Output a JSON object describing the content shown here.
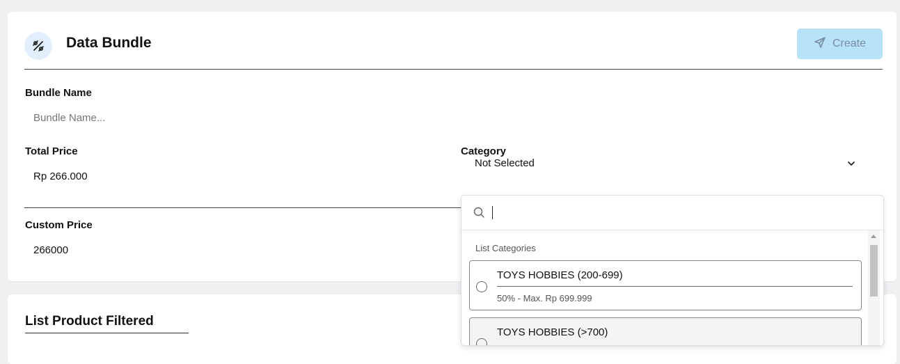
{
  "header": {
    "title": "Data Bundle",
    "icon": "percent-tag-icon",
    "create_label": "Create",
    "create_icon": "send-icon"
  },
  "form": {
    "bundle_name": {
      "label": "Bundle Name",
      "value": "",
      "placeholder": "Bundle Name..."
    },
    "total_price": {
      "label": "Total Price",
      "value": "Rp 266.000"
    },
    "category": {
      "label": "Category",
      "selected": "Not Selected"
    },
    "custom_price": {
      "label": "Custom Price",
      "value": "266000"
    }
  },
  "dropdown": {
    "search_value": "",
    "list_label": "List Categories",
    "options": [
      {
        "title": "TOYS HOBBIES (200-699)",
        "subtitle": "50% - Max. Rp 699.999"
      },
      {
        "title": "TOYS HOBBIES (>700)",
        "subtitle": ""
      }
    ]
  },
  "list_section": {
    "title": "List Product Filtered"
  },
  "colors": {
    "accent_light": "#b8e2f8",
    "icon_badge_bg": "#e3eefc",
    "page_bg": "#f0f0f3"
  }
}
